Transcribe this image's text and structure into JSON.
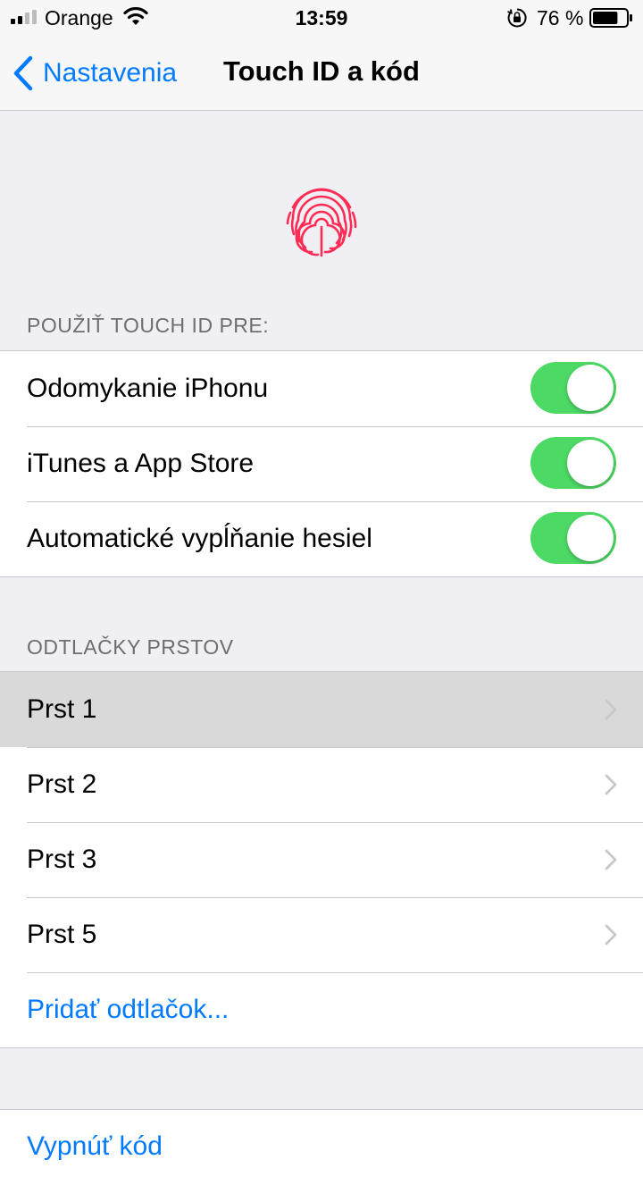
{
  "status_bar": {
    "carrier": "Orange",
    "time": "13:59",
    "battery_percent": "76 %",
    "battery_level": 0.76
  },
  "nav": {
    "back_label": "Nastavenia",
    "title": "Touch ID a kód"
  },
  "colors": {
    "accent": "#007aff",
    "toggle_on": "#4cd964",
    "fingerprint": "#ff2d55"
  },
  "touch_id_section": {
    "header": "POUŽIŤ TOUCH ID PRE:",
    "items": [
      {
        "label": "Odomykanie iPhonu",
        "enabled": true
      },
      {
        "label": "iTunes a App Store",
        "enabled": true
      },
      {
        "label": "Automatické vypĺňanie hesiel",
        "enabled": true
      }
    ]
  },
  "fingerprints_section": {
    "header": "ODTLAČKY PRSTOV",
    "items": [
      {
        "label": "Prst 1"
      },
      {
        "label": "Prst 2"
      },
      {
        "label": "Prst 3"
      },
      {
        "label": "Prst 5"
      }
    ],
    "add_label": "Pridať odtlačok..."
  },
  "passcode_section": {
    "turn_off_label": "Vypnúť kód"
  }
}
